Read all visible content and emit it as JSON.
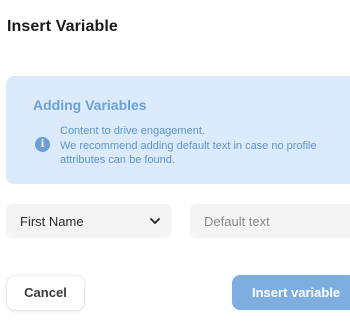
{
  "dialog": {
    "title": "Insert Variable"
  },
  "info": {
    "title": "Adding Variables",
    "icon": "info-icon",
    "icon_glyph": "i",
    "lines": [
      "Content to drive engagement.",
      "We recommend adding default text in case no profile",
      "attributes can be found."
    ]
  },
  "variable_select": {
    "selected": "First Name",
    "icon": "chevron-down-icon"
  },
  "default_text": {
    "value": "",
    "placeholder": "Default text"
  },
  "actions": {
    "cancel_label": "Cancel",
    "insert_label": "Insert variable"
  },
  "colors": {
    "info_background": "#dcebfb",
    "info_text": "#5d94cc",
    "primary_button": "#7eaee0"
  }
}
